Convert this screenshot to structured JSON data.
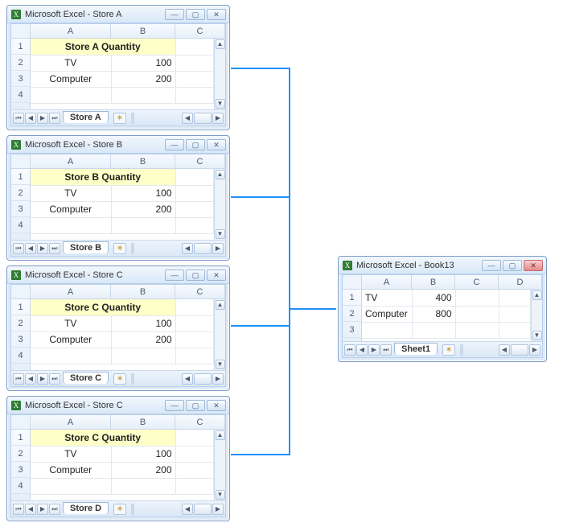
{
  "windows": [
    {
      "title": "Microsoft Excel - Store A",
      "sheet_tab": "Store A",
      "cols": [
        "A",
        "B",
        "C"
      ],
      "rows": [
        "1",
        "2",
        "3",
        "4"
      ],
      "header_merge": "Store A Quantity",
      "data": [
        {
          "label": "TV",
          "value": "100"
        },
        {
          "label": "Computer",
          "value": "200"
        }
      ]
    },
    {
      "title": "Microsoft Excel - Store B",
      "sheet_tab": "Store B",
      "cols": [
        "A",
        "B",
        "C"
      ],
      "rows": [
        "1",
        "2",
        "3",
        "4"
      ],
      "header_merge": "Store B Quantity",
      "data": [
        {
          "label": "TV",
          "value": "100"
        },
        {
          "label": "Computer",
          "value": "200"
        }
      ]
    },
    {
      "title": "Microsoft Excel - Store C",
      "sheet_tab": "Store C",
      "cols": [
        "A",
        "B",
        "C"
      ],
      "rows": [
        "1",
        "2",
        "3",
        "4"
      ],
      "header_merge": "Store C Quantity",
      "data": [
        {
          "label": "TV",
          "value": "100"
        },
        {
          "label": "Computer",
          "value": "200"
        }
      ]
    },
    {
      "title": "Microsoft Excel - Store C",
      "sheet_tab": "Store D",
      "cols": [
        "A",
        "B",
        "C"
      ],
      "rows": [
        "1",
        "2",
        "3",
        "4"
      ],
      "header_merge": "Store C Quantity",
      "data": [
        {
          "label": "TV",
          "value": "100"
        },
        {
          "label": "Computer",
          "value": "200"
        }
      ]
    }
  ],
  "result": {
    "title": "Microsoft Excel - Book13",
    "sheet_tab": "Sheet1",
    "cols": [
      "A",
      "B",
      "C",
      "D"
    ],
    "rows": [
      "1",
      "2",
      "3"
    ],
    "data": [
      {
        "label": "TV",
        "value": "400"
      },
      {
        "label": "Computer",
        "value": "800"
      }
    ]
  }
}
